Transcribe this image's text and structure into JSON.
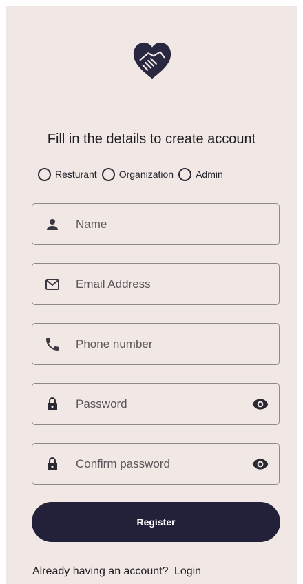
{
  "logo": {
    "icon": "heart-handshake-icon",
    "color": "#2a2840"
  },
  "title": "Fill in the details to create account",
  "roles": [
    {
      "label": "Resturant",
      "selected": false
    },
    {
      "label": "Organization",
      "selected": false
    },
    {
      "label": "Admin",
      "selected": false
    }
  ],
  "fields": {
    "name": {
      "placeholder": "Name",
      "icon": "person-icon"
    },
    "email": {
      "placeholder": "Email Address",
      "icon": "mail-icon"
    },
    "phone": {
      "placeholder": "Phone number",
      "icon": "phone-icon"
    },
    "password": {
      "placeholder": "Password",
      "icon": "lock-icon",
      "toggle_icon": "eye-icon"
    },
    "confirm_password": {
      "placeholder": "Confirm password",
      "icon": "lock-icon",
      "toggle_icon": "eye-icon"
    }
  },
  "register_label": "Register",
  "footer": {
    "text": "Already having an account?",
    "link_label": "Login"
  },
  "colors": {
    "background": "#f1e8e5",
    "primary": "#23213a",
    "field_border": "#8e8a8c"
  }
}
